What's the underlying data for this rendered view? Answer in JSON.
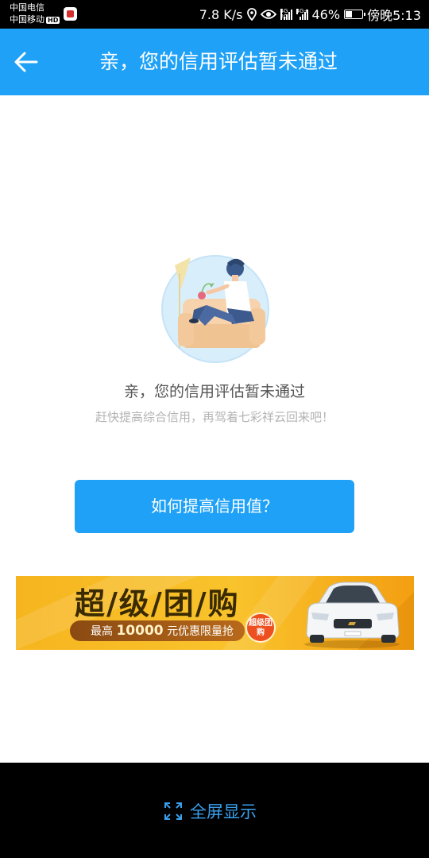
{
  "status_bar": {
    "carrier_1": "中国电信",
    "carrier_2": "中国移动",
    "hd_badge": "HD",
    "network_speed": "7.8 K/s",
    "signal_1_label": "4G 2G",
    "signal_2_label": "4G+",
    "battery": "46%",
    "battery_level": 0.46,
    "time": "傍晚5:13",
    "icons": [
      "app-icon",
      "location-icon",
      "eye-icon",
      "signal-icon",
      "battery-icon"
    ]
  },
  "header": {
    "title": "亲，您的信用评估暂未通过",
    "back_icon": "arrow-left-icon",
    "background": "#1ea1f7"
  },
  "main": {
    "illustration_icon": "person-on-sofa-illustration",
    "message": "亲，您的信用评估暂未通过",
    "sub_message": "赶快提高综合信用，再驾着七彩祥云回来吧！",
    "button_label": "如何提高信用值？"
  },
  "banner": {
    "title": "超/级/团/购",
    "promo_prefix": "最高",
    "promo_amount": "10000",
    "promo_suffix": "元优惠限量抢",
    "badge": "超级团购",
    "car_icon": "white-car-illustration"
  },
  "footer": {
    "fullscreen_label": "全屏显示",
    "fullscreen_icon": "expand-icon",
    "accent": "#3aa0ee"
  }
}
